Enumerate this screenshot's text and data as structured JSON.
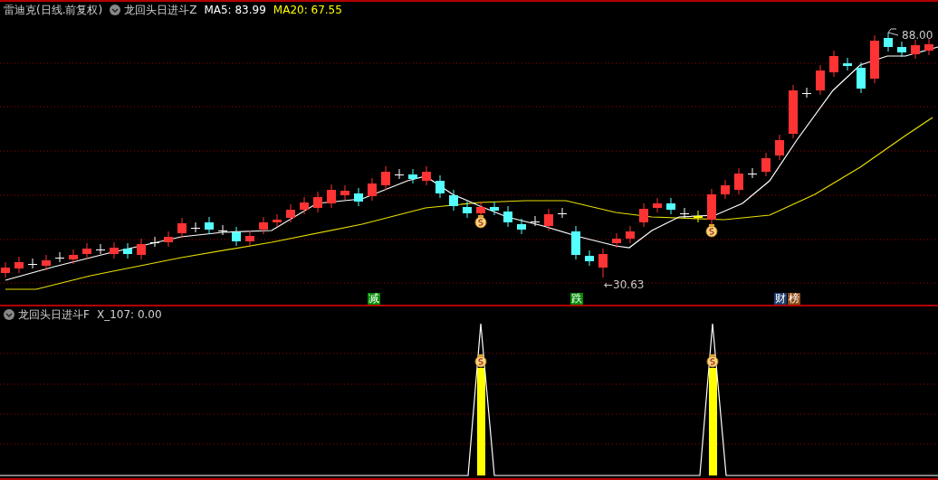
{
  "main_panel": {
    "title": "雷迪克(日线.前复权)",
    "indicator": "龙回头日进斗Z",
    "ma5": "MA5: 83.99",
    "ma20": "MA20: 67.55",
    "high_label": "88.00",
    "low_label": "←30.63"
  },
  "markers": [
    {
      "text": "减",
      "color": "#008a00"
    },
    {
      "text": "跌",
      "color": "#008a00"
    },
    {
      "text": "财",
      "color": "#1c3d6e"
    },
    {
      "text": "榜",
      "color": "#8c4a12"
    }
  ],
  "sub_panel": {
    "indicator": "龙回头日进斗F",
    "value": "X_107: 0.00"
  }
}
